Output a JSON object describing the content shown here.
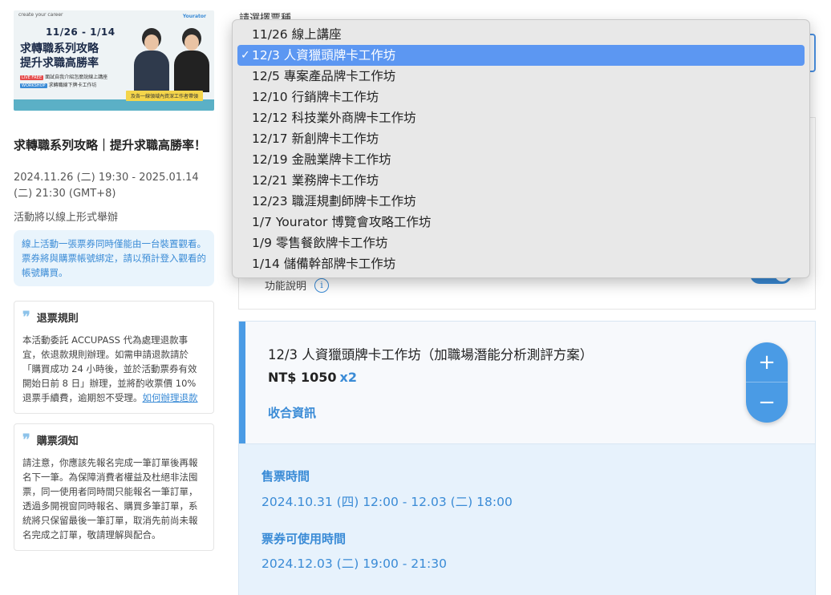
{
  "banner": {
    "head": "create your career",
    "dates": "11/26 - 1/14",
    "title_line1": "求轉職系列攻略",
    "title_line2": "提升求職高勝率",
    "line1_tag": "LIVE FREE",
    "line1_text": "面試自我介紹怎麼說線上講座",
    "line2_tag": "WORKSHOP",
    "line2_text": "求轉職線下牌卡工作坊",
    "cta": "及各一線領域內資深工作者帶領",
    "logo": "Yourator"
  },
  "event": {
    "title": "求轉職系列攻略｜提升求職高勝率！",
    "date": "2024.11.26 (二) 19:30 - 2025.01.14 (二) 21:30 (GMT+8)",
    "mode": "活動將以線上形式舉辦",
    "notice": "線上活動一張票券同時僅能由一台裝置觀看。票券將與購票帳號綁定，請以預計登入觀看的帳號購買。"
  },
  "refund": {
    "title": "退票規則",
    "body": "本活動委託 ACCUPASS 代為處理退款事宜，依退款規則辦理。如需申請退款請於「購買成功 24 小時後，並於活動票券有效開始日前 8 日」辦理，並將酌收票價 10% 退票手續費，逾期恕不受理。",
    "link": "如何辦理退款"
  },
  "purchase": {
    "title": "購票須知",
    "body": "請注意，你應該先報名完成一筆訂單後再報名下一筆。為保障消費者權益及杜絕非法囤票，同一使用者同時間只能報名一筆訂單，透過多開視窗同時報名、購買多筆訂單，系統將只保留最後一筆訂單，取消先前尚未報名完成之訂單，敬請理解與配合。"
  },
  "select": {
    "label": "請選擇票種",
    "selected_index": 1,
    "options": [
      "11/26 線上講座",
      "12/3 人資獵頭牌卡工作坊",
      "12/5 專案產品牌卡工作坊",
      "12/10 行銷牌卡工作坊",
      "12/12 科技業外商牌卡工作坊",
      "12/17 新創牌卡工作坊",
      "12/19 金融業牌卡工作坊",
      "12/21 業務牌卡工作坊",
      "12/23 職涯規劃師牌卡工作坊",
      "1/7 Yourator 博覽會攻略工作坊",
      "1/9 零售餐飲牌卡工作坊",
      "1/14 儲備幹部牌卡工作坊"
    ],
    "check": "✓"
  },
  "function": {
    "label": "功能說明",
    "toggle_on": true
  },
  "ticket": {
    "name": "12/3 人資獵頭牌卡工作坊（加職場潛能分析測評方案）",
    "price": "NT$ 1050",
    "qty": "x2",
    "collapse": "收合資訊",
    "sale_label": "售票時間",
    "sale_time": "2024.10.31 (四) 12:00 - 12.03 (二) 18:00",
    "use_label": "票券可使用時間",
    "use_time": "2024.12.03 (二) 19:00 - 21:30"
  },
  "colors": {
    "accent": "#3a8bd6",
    "selected": "#5c97f2"
  }
}
